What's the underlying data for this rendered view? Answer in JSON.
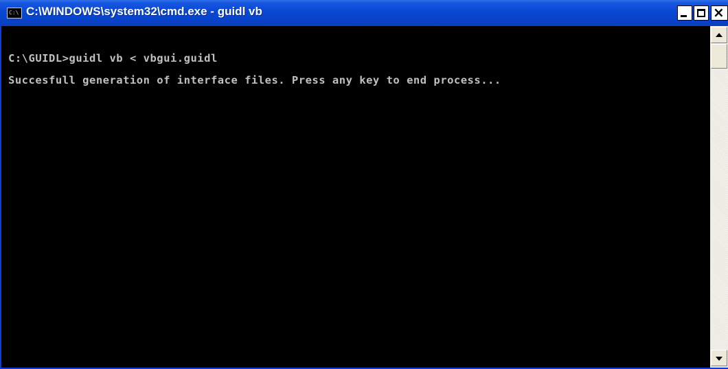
{
  "window": {
    "title": "C:\\WINDOWS\\system32\\cmd.exe - guidl vb",
    "icon_label": "C:\\",
    "icon": "console-app-icon"
  },
  "console": {
    "lines": [
      "C:\\GUIDL>guidl vb < vbgui.guidl",
      "Succesfull generation of interface files. Press any key to end process..."
    ]
  },
  "colors": {
    "titlebar": "#0a49d6",
    "console_bg": "#000000",
    "console_text": "#c0c0c0"
  }
}
